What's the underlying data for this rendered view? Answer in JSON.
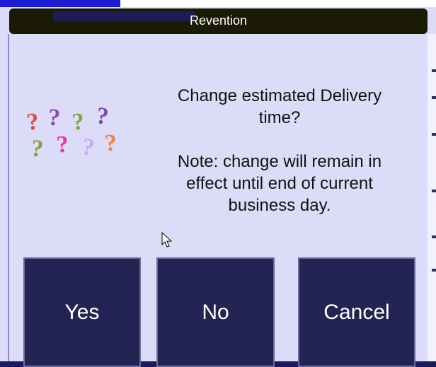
{
  "dialog": {
    "title": "Revention",
    "message_lines": [
      "Change estimated Delivery",
      "time?"
    ],
    "note_lines": [
      "Note: change will remain in",
      "effect until end of current",
      "business day."
    ],
    "icon": "question-marks-icon"
  },
  "buttons": {
    "yes": "Yes",
    "no": "No",
    "cancel": "Cancel"
  },
  "colors": {
    "dialog_bg": "#dcdcf8",
    "button_bg": "#242454",
    "titlebar_bg": "#1a1a05"
  },
  "question_marks": [
    {
      "char": "?",
      "color": "#e04848"
    },
    {
      "char": "?",
      "color": "#8a4ab8"
    },
    {
      "char": "?",
      "color": "#7aa83a"
    },
    {
      "char": "?",
      "color": "#7a4ab0"
    },
    {
      "char": "?",
      "color": "#7aa83a"
    },
    {
      "char": "?",
      "color": "#e838a8"
    },
    {
      "char": "?",
      "color": "#c8a8f0"
    },
    {
      "char": "?",
      "color": "#f08838"
    }
  ]
}
